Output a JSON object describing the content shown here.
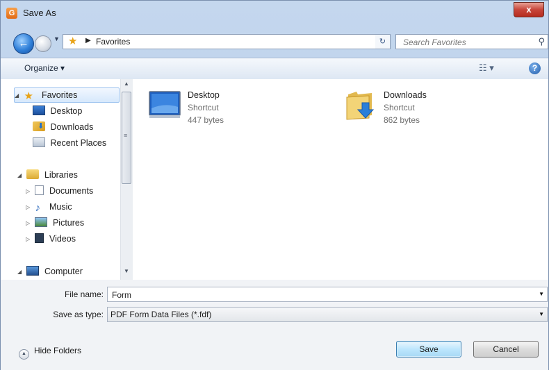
{
  "window": {
    "title": "Save As",
    "app_icon": "app-icon-orange",
    "close_label": "x"
  },
  "nav": {
    "breadcrumb": "Favorites",
    "search_placeholder": "Search Favorites"
  },
  "toolbar": {
    "organize_label": "Organize ▾",
    "view_icon": "view-options-icon",
    "help_label": "?"
  },
  "sidebar": {
    "favorites": {
      "label": "Favorites",
      "items": [
        {
          "label": "Desktop",
          "icon": "desktop-icon"
        },
        {
          "label": "Downloads",
          "icon": "downloads-icon"
        },
        {
          "label": "Recent Places",
          "icon": "recent-places-icon"
        }
      ]
    },
    "libraries": {
      "label": "Libraries",
      "items": [
        {
          "label": "Documents",
          "icon": "documents-icon"
        },
        {
          "label": "Music",
          "icon": "music-icon"
        },
        {
          "label": "Pictures",
          "icon": "pictures-icon"
        },
        {
          "label": "Videos",
          "icon": "videos-icon"
        }
      ]
    },
    "computer": {
      "label": "Computer"
    }
  },
  "files": [
    {
      "name": "Desktop",
      "type": "Shortcut",
      "size": "447 bytes",
      "icon": "desktop-large-icon"
    },
    {
      "name": "Downloads",
      "type": "Shortcut",
      "size": "862 bytes",
      "icon": "downloads-large-icon"
    }
  ],
  "form": {
    "filename_label": "File name:",
    "filename_value": "Form",
    "savetype_label": "Save as type:",
    "savetype_value": "PDF Form Data Files (*.fdf)"
  },
  "footer": {
    "hide_folders_label": "Hide Folders",
    "save_label": "Save",
    "cancel_label": "Cancel"
  },
  "colors": {
    "accent": "#3c7fb1",
    "window_frame": "#b6cbe6",
    "selection": "#d6e8fc"
  }
}
